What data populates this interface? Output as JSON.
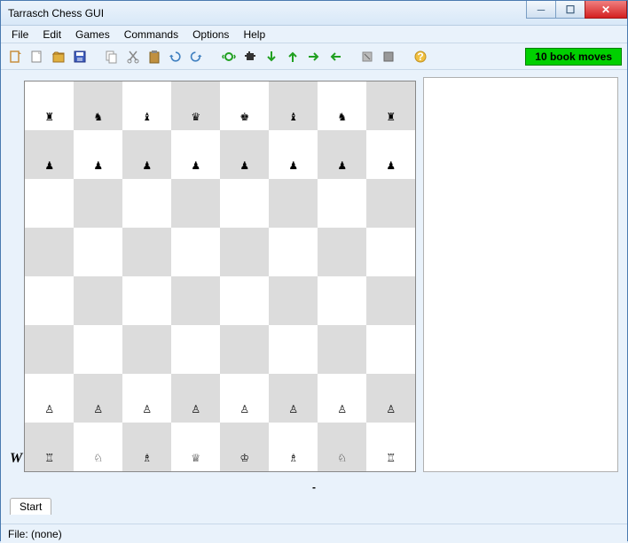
{
  "window": {
    "title": "Tarrasch Chess GUI"
  },
  "menu": {
    "items": [
      "File",
      "Edit",
      "Games",
      "Commands",
      "Options",
      "Help"
    ]
  },
  "toolbar": {
    "icons": [
      "new-game",
      "open",
      "save",
      "save-as",
      "sep",
      "copy",
      "cut",
      "paste",
      "undo",
      "redo",
      "sep",
      "engine",
      "kibitz",
      "move-down",
      "move-up",
      "move-right",
      "move-left",
      "sep",
      "flip",
      "swap",
      "sep",
      "help"
    ],
    "book_moves": "10 book moves"
  },
  "board": {
    "turn_indicator": "W",
    "rows": [
      [
        "r",
        "n",
        "b",
        "q",
        "k",
        "b",
        "n",
        "r"
      ],
      [
        "p",
        "p",
        "p",
        "p",
        "p",
        "p",
        "p",
        "p"
      ],
      [
        "",
        "",
        "",
        "",
        "",
        "",
        "",
        ""
      ],
      [
        "",
        "",
        "",
        "",
        "",
        "",
        "",
        ""
      ],
      [
        "",
        "",
        "",
        "",
        "",
        "",
        "",
        ""
      ],
      [
        "",
        "",
        "",
        "",
        "",
        "",
        "",
        ""
      ],
      [
        "P",
        "P",
        "P",
        "P",
        "P",
        "P",
        "P",
        "P"
      ],
      [
        "R",
        "N",
        "B",
        "Q",
        "K",
        "B",
        "N",
        "R"
      ]
    ]
  },
  "below_board": "-",
  "tabs": {
    "start": "Start"
  },
  "status": {
    "file": "File: (none)"
  },
  "piece_map": {
    "K": "♔",
    "Q": "♕",
    "R": "♖",
    "B": "♗",
    "N": "♘",
    "P": "♙",
    "k": "♚",
    "q": "♛",
    "r": "♜",
    "b": "♝",
    "n": "♞",
    "p": "♟"
  }
}
